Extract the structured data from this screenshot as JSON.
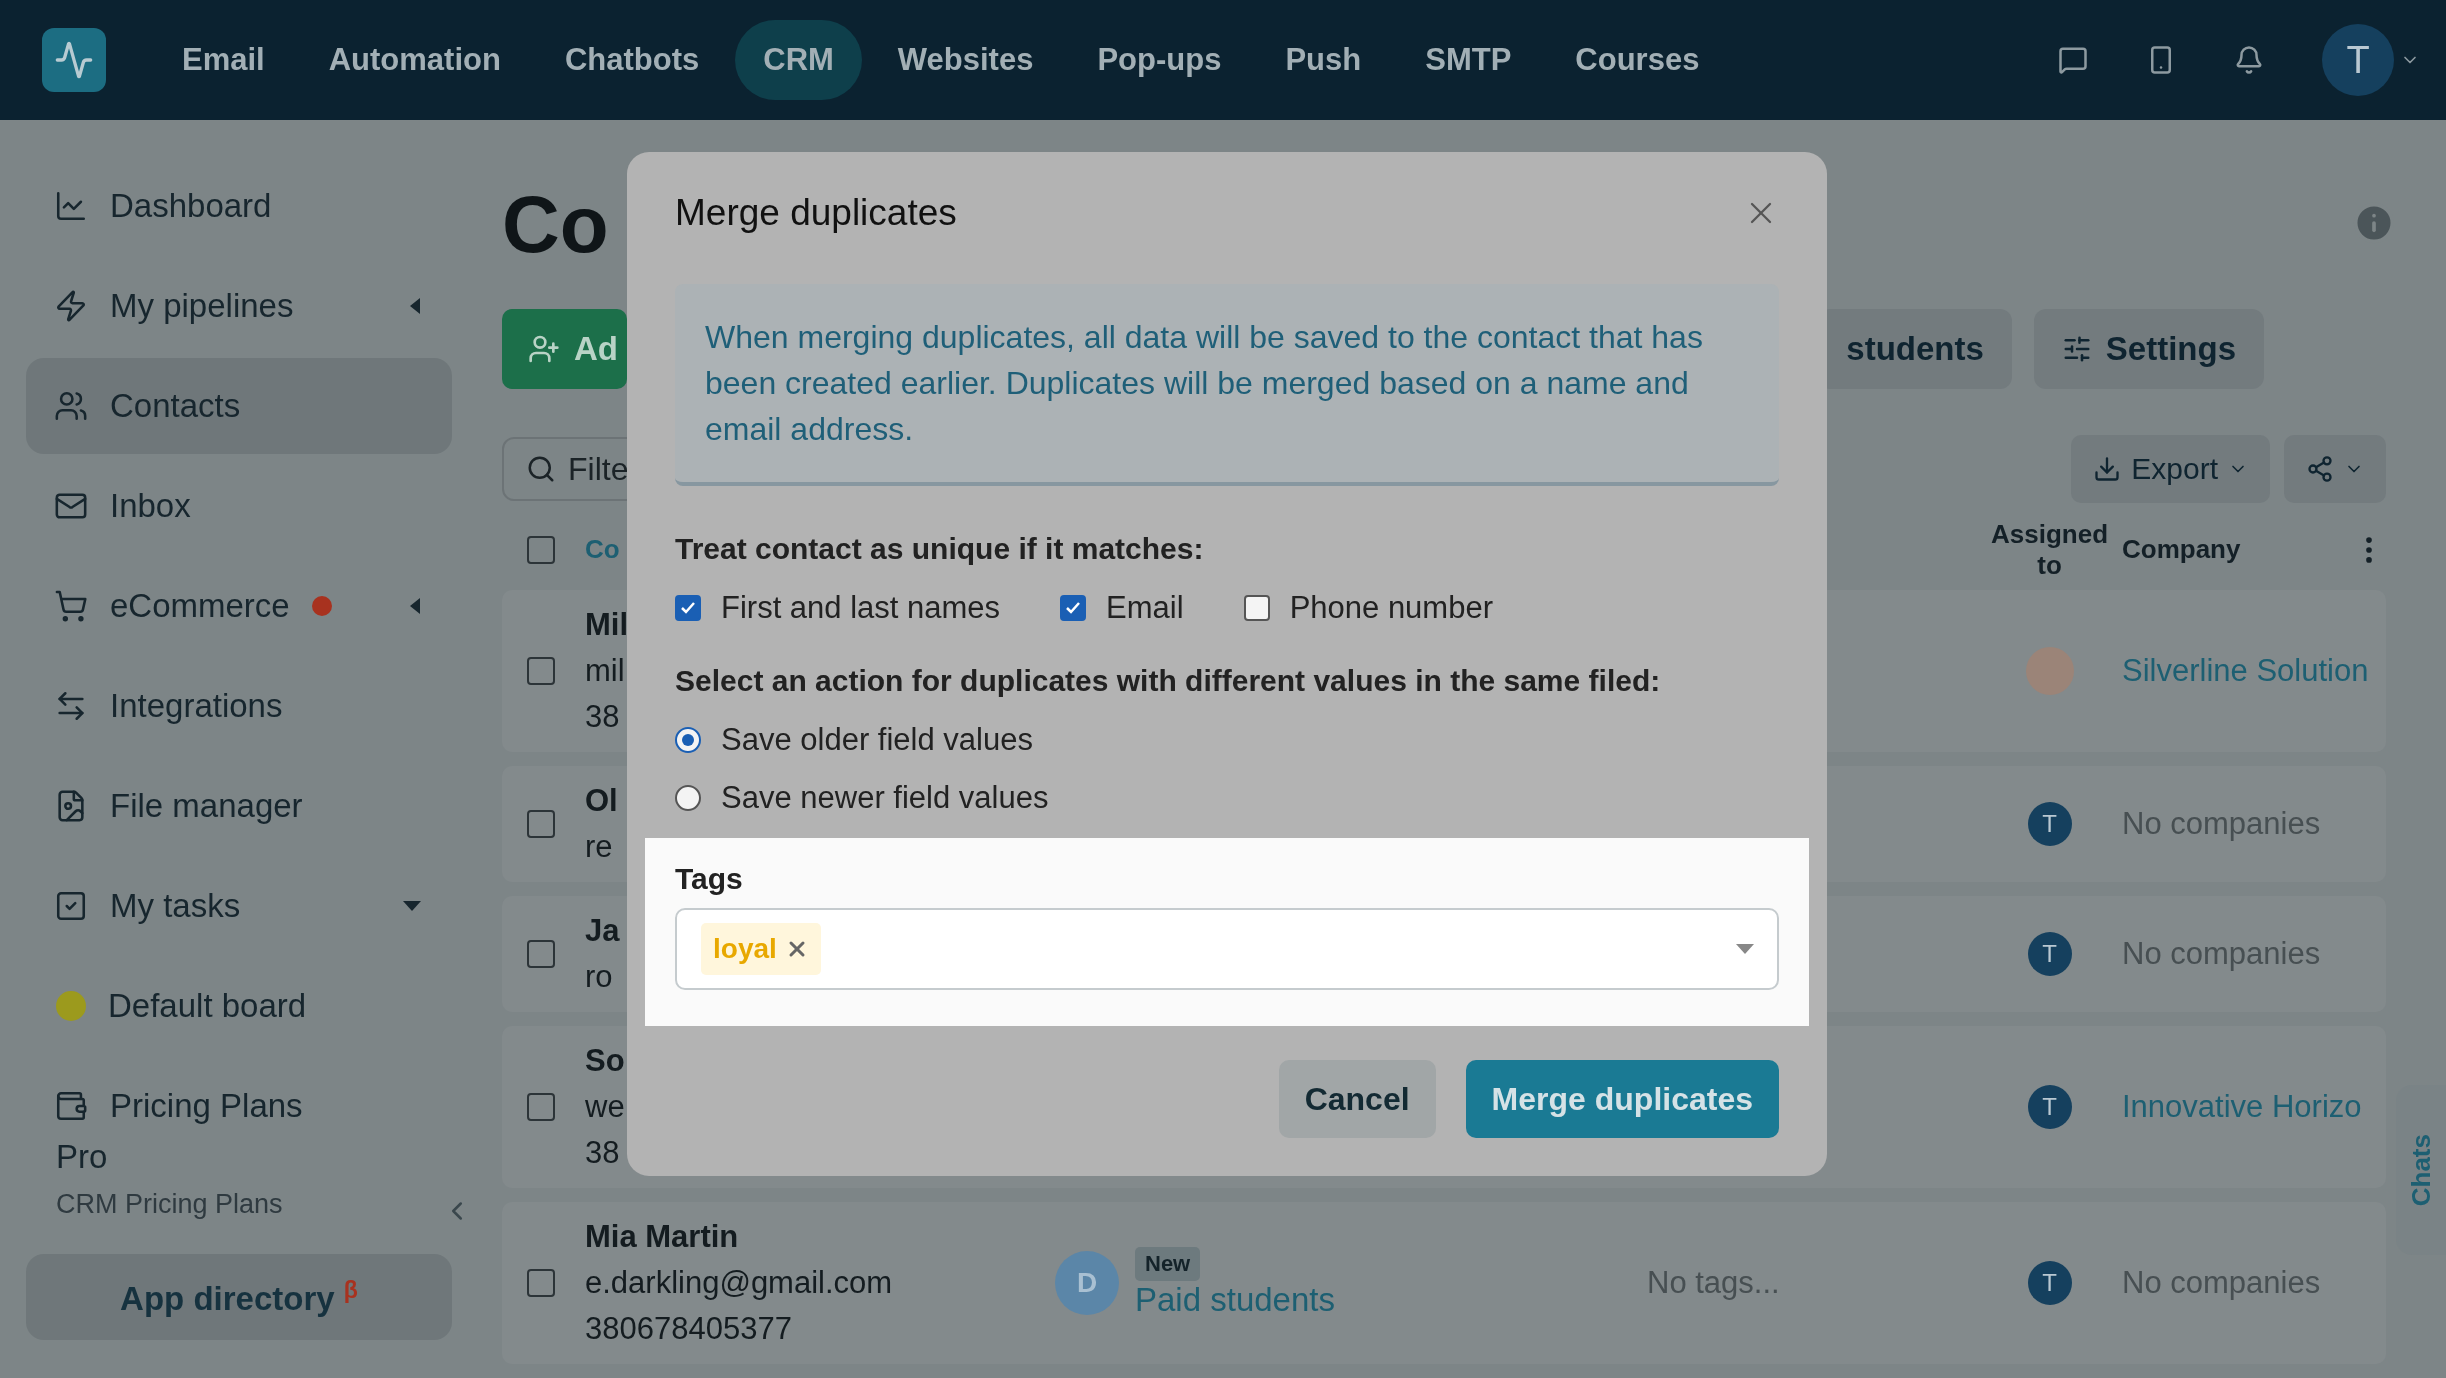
{
  "top_nav": {
    "items": [
      {
        "label": "Email",
        "selected": false
      },
      {
        "label": "Automation",
        "selected": false
      },
      {
        "label": "Chatbots",
        "selected": false
      },
      {
        "label": "CRM",
        "selected": true
      },
      {
        "label": "Websites",
        "selected": false
      },
      {
        "label": "Pop-ups",
        "selected": false
      },
      {
        "label": "Push",
        "selected": false
      },
      {
        "label": "SMTP",
        "selected": false
      },
      {
        "label": "Courses",
        "selected": false
      }
    ],
    "avatar": "T"
  },
  "sidebar": {
    "items": [
      {
        "label": "Dashboard",
        "kind": "link",
        "selected": false,
        "notification": false
      },
      {
        "label": "My pipelines",
        "kind": "submenu",
        "selected": false,
        "notification": false
      },
      {
        "label": "Contacts",
        "kind": "link",
        "selected": true,
        "notification": false
      },
      {
        "label": "Inbox",
        "kind": "link",
        "selected": false,
        "notification": false
      },
      {
        "label": "eCommerce",
        "kind": "submenu",
        "selected": false,
        "notification": true
      },
      {
        "label": "Integrations",
        "kind": "link",
        "selected": false,
        "notification": false
      },
      {
        "label": "File manager",
        "kind": "link",
        "selected": false,
        "notification": false
      },
      {
        "label": "My tasks",
        "kind": "dropdown",
        "selected": false,
        "notification": false
      },
      {
        "label": "Default board",
        "kind": "board",
        "selected": false,
        "notification": false
      },
      {
        "label": "Pricing Plans",
        "kind": "link",
        "selected": false,
        "notification": false
      }
    ],
    "plan": {
      "name": "Pro",
      "subtitle": "CRM Pricing Plans"
    },
    "app_directory": "App directory $^{β}$"
  },
  "main": {
    "title": "Co",
    "add_button": "Ad",
    "toolbar_buttons": [
      "students",
      "Settings"
    ],
    "filter_placeholder": "Filte",
    "export_button": "Export",
    "header_checked": false,
    "columns": [
      "Co",
      "Assigned to",
      "Company"
    ],
    "rows": [
      {
        "checked": false,
        "contact": [
          "Mil",
          "mil",
          "38"
        ],
        "assigned": {
          "kind": "image"
        },
        "company": {
          "text": "Silverline Solution",
          "linked": true
        }
      },
      {
        "checked": false,
        "contact": [
          "Ol",
          "re"
        ],
        "assigned": {
          "kind": "letter",
          "text": "T"
        },
        "company": {
          "text": "No companies",
          "linked": false
        }
      },
      {
        "checked": false,
        "contact": [
          "Ja",
          "ro"
        ],
        "assigned": {
          "kind": "letter",
          "text": "T"
        },
        "company": {
          "text": "No companies",
          "linked": false
        }
      },
      {
        "checked": false,
        "contact": [
          "So",
          "we",
          "38"
        ],
        "assigned": {
          "kind": "letter",
          "text": "T"
        },
        "company": {
          "text": "Innovative Horizo",
          "linked": true
        }
      },
      {
        "checked": false,
        "contact": [
          "Mia Martin",
          "e.darkling@gmail.com",
          "380678405377"
        ],
        "deal": {
          "avatar": "D",
          "badge": "New",
          "name": "Paid students"
        },
        "tags": "No tags...",
        "assigned": {
          "kind": "letter",
          "text": "T"
        },
        "company": {
          "text": "No companies",
          "linked": false
        }
      }
    ]
  },
  "modal": {
    "title": "Merge duplicates",
    "info": "When merging duplicates, all data will be saved to the contact that has been created earlier. Duplicates will be merged based on a name and email address.",
    "unique_label": "Treat contact as unique if it matches:",
    "unique_options": [
      {
        "label": "First and last names",
        "checked": true
      },
      {
        "label": "Email",
        "checked": true
      },
      {
        "label": "Phone number",
        "checked": false
      }
    ],
    "action_label": "Select an action for duplicates with different values in the same filed:",
    "actions": [
      {
        "label": "Save older field values",
        "selected": true
      },
      {
        "label": "Save newer field values",
        "selected": false
      }
    ],
    "tags": {
      "label": "Tags",
      "values": [
        "loyal"
      ]
    },
    "buttons": [
      {
        "label": "Cancel",
        "kind": "secondary"
      },
      {
        "label": "Merge duplicates",
        "kind": "primary"
      }
    ]
  },
  "chats_tab": "Chats"
}
